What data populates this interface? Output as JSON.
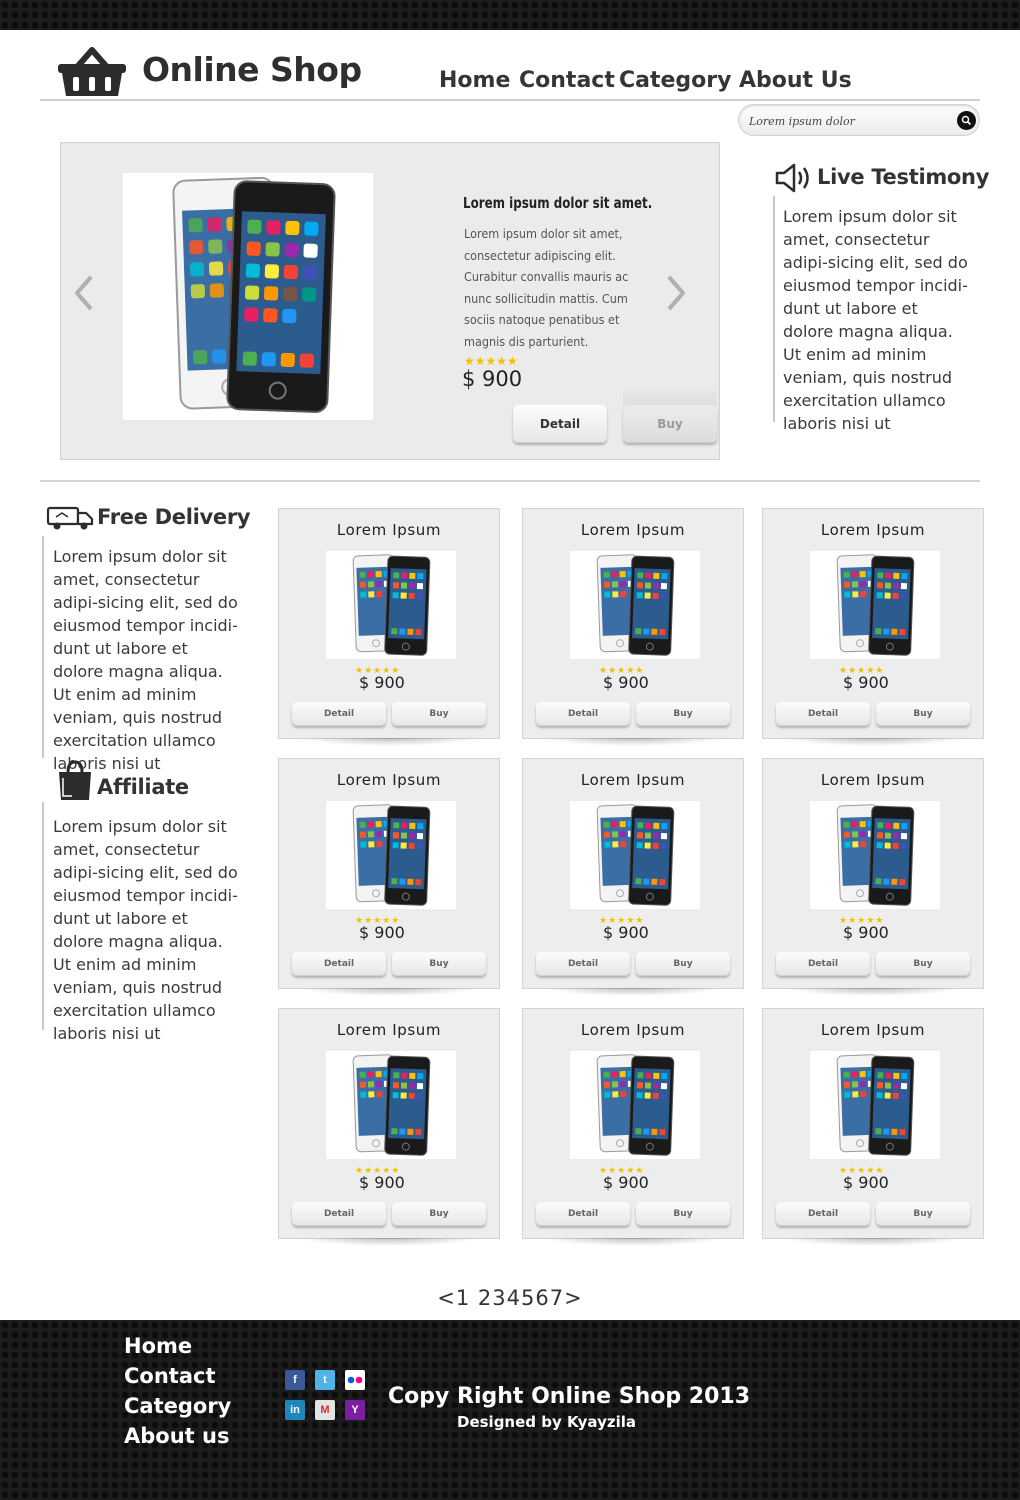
{
  "header": {
    "brand": "Online Shop",
    "nav": [
      "Home",
      "Contact",
      "Category",
      "About Us"
    ],
    "search_placeholder": "Lorem ipsum dolor"
  },
  "featured": {
    "title": "Lorem ipsum dolor sit amet.",
    "description": "Lorem ipsum dolor sit amet, consectetur adipiscing elit. Curabitur convallis mauris ac nunc sollicitudin mattis. Cum sociis natoque penatibus et magnis dis parturient.",
    "stars": "★★★★★",
    "rating": 5,
    "price": "$ 900",
    "detail_label": "Detail",
    "buy_label": "Buy"
  },
  "testimony": {
    "title": "Live Testimony",
    "text": "Lorem ipsum dolor sit amet, consectetur adipi-sicing elit, sed do eiusmod tempor incidi-dunt ut labore et dolore magna aliqua. Ut enim ad minim veniam, quis nostrud exercitation ullamco laboris nisi ut"
  },
  "delivery": {
    "title": "Free Delivery",
    "text": "Lorem ipsum dolor sit amet, consectetur adipi-sicing elit, sed do eiusmod tempor incidi-dunt ut labore et dolore magna aliqua. Ut enim ad minim veniam, quis nostrud exercitation ullamco laboris nisi ut"
  },
  "affiliate": {
    "title": "Affiliate",
    "text": "Lorem ipsum dolor sit amet, consectetur adipi-sicing elit, sed do eiusmod tempor incidi-dunt ut labore et dolore magna aliqua. Ut enim ad minim veniam, quis nostrud exercitation ullamco laboris nisi ut"
  },
  "products": [
    {
      "title": "Lorem Ipsum",
      "stars": "★★★★★",
      "price": "$ 900",
      "detail": "Detail",
      "buy": "Buy"
    },
    {
      "title": "Lorem Ipsum",
      "stars": "★★★★★",
      "price": "$ 900",
      "detail": "Detail",
      "buy": "Buy"
    },
    {
      "title": "Lorem Ipsum",
      "stars": "★★★★★",
      "price": "$ 900",
      "detail": "Detail",
      "buy": "Buy"
    },
    {
      "title": "Lorem Ipsum",
      "stars": "★★★★★",
      "price": "$ 900",
      "detail": "Detail",
      "buy": "Buy"
    },
    {
      "title": "Lorem Ipsum",
      "stars": "★★★★★",
      "price": "$ 900",
      "detail": "Detail",
      "buy": "Buy"
    },
    {
      "title": "Lorem Ipsum",
      "stars": "★★★★★",
      "price": "$ 900",
      "detail": "Detail",
      "buy": "Buy"
    },
    {
      "title": "Lorem Ipsum",
      "stars": "★★★★★",
      "price": "$ 900",
      "detail": "Detail",
      "buy": "Buy"
    },
    {
      "title": "Lorem Ipsum",
      "stars": "★★★★★",
      "price": "$ 900",
      "detail": "Detail",
      "buy": "Buy"
    },
    {
      "title": "Lorem Ipsum",
      "stars": "★★★★★",
      "price": "$ 900",
      "detail": "Detail",
      "buy": "Buy"
    }
  ],
  "pagination": {
    "prev": "<",
    "pages": [
      "1",
      "2",
      "3",
      "4",
      "5",
      "6",
      "7"
    ],
    "next": ">"
  },
  "footer": {
    "nav": [
      "Home",
      "Contact",
      "Category",
      "About us"
    ],
    "social": [
      {
        "name": "facebook-icon",
        "glyph": "f",
        "color": "#3b5998"
      },
      {
        "name": "twitter-icon",
        "glyph": "t",
        "color": "#4fb3e8"
      },
      {
        "name": "flickr-icon",
        "glyph": "",
        "color": "#ffffff"
      },
      {
        "name": "linkedin-icon",
        "glyph": "in",
        "color": "#1d87be"
      },
      {
        "name": "gmail-icon",
        "glyph": "M",
        "color": "#e4e4e4"
      },
      {
        "name": "yahoo-icon",
        "glyph": "Y",
        "color": "#7b1fa2"
      }
    ],
    "copyright": "Copy Right Online Shop 2013",
    "designed_by": "Designed by Kyayzila"
  },
  "colors": {
    "star": "#f2c100",
    "dark_bar": "#1c1c1c",
    "card_bg": "#ededed"
  }
}
